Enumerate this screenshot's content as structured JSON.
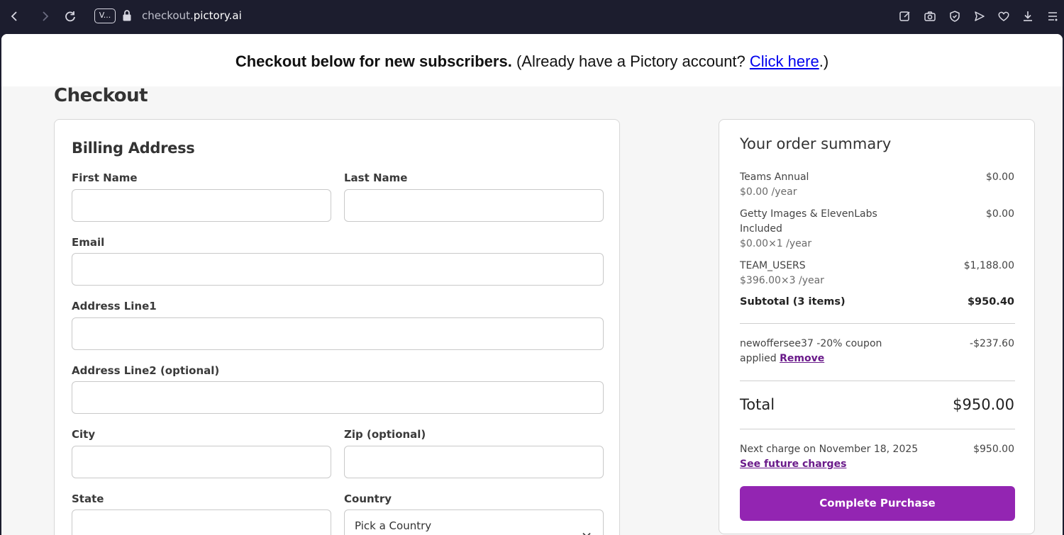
{
  "browser": {
    "tab_badge": "V...",
    "url_prefix": "checkout.",
    "url_domain": "pictory.ai",
    "icons": [
      "back-icon",
      "forward-icon",
      "reload-icon",
      "tab-icon",
      "lock-icon",
      "edit-icon",
      "camera-icon",
      "shield-icon",
      "send-icon",
      "heart-icon",
      "download-icon",
      "menu-icon"
    ]
  },
  "banner": {
    "bold_text": "Checkout below for new subscribers.",
    "text_before_link": " (Already have a Pictory account? ",
    "link_text": "Click here",
    "text_after_link": ".)"
  },
  "page": {
    "title": "Checkout"
  },
  "billing": {
    "heading": "Billing Address",
    "first_name_label": "First Name",
    "first_name_value": "",
    "last_name_label": "Last Name",
    "last_name_value": "",
    "email_label": "Email",
    "email_value": "",
    "address1_label": "Address Line1",
    "address1_value": "",
    "address2_label": "Address Line2 (optional)",
    "address2_value": "",
    "city_label": "City",
    "city_value": "",
    "zip_label": "Zip (optional)",
    "zip_value": "",
    "state_label": "State",
    "state_value": "",
    "country_label": "Country",
    "country_selected": "Pick a Country"
  },
  "summary": {
    "heading": "Your order summary",
    "items": [
      {
        "name": "Teams Annual",
        "sub": "$0.00 /year",
        "amount": "$0.00"
      },
      {
        "name": "Getty Images & ElevenLabs",
        "name2": "Included",
        "sub": "$0.00×1 /year",
        "amount": "$0.00"
      },
      {
        "name": "TEAM_USERS",
        "sub": "$396.00×3 /year",
        "amount": "$1,188.00"
      }
    ],
    "subtotal_label": "Subtotal (3 items)",
    "subtotal_amount": "$950.40",
    "coupon_line1": "newoffersee37 -20% coupon",
    "coupon_line2": "applied ",
    "coupon_remove": "Remove",
    "coupon_amount": "-$237.60",
    "total_label": "Total",
    "total_amount": "$950.00",
    "next_charge_label": "Next charge on November 18, 2025",
    "next_charge_amount": "$950.00",
    "future_charges_link": "See future charges",
    "purchase_button": "Complete Purchase"
  },
  "colors": {
    "accent": "#9325b2",
    "link_purple": "#6a1a8a",
    "link_blue": "#0000ee",
    "chrome_bg": "#1c1d2e"
  }
}
